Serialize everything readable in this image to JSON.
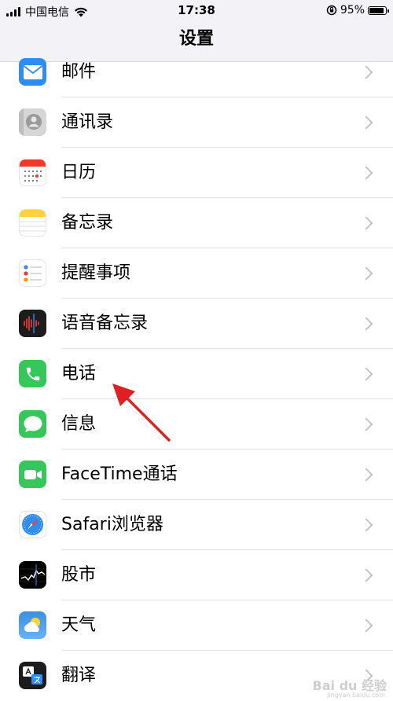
{
  "status_bar": {
    "carrier": "中国电信",
    "time": "17:38",
    "battery": "95%",
    "battery_level": 0.95
  },
  "nav": {
    "title": "设置"
  },
  "settings": [
    {
      "label": "邮件",
      "icon": "mail-icon"
    },
    {
      "label": "通讯录",
      "icon": "contacts-icon"
    },
    {
      "label": "日历",
      "icon": "calendar-icon"
    },
    {
      "label": "备忘录",
      "icon": "notes-icon"
    },
    {
      "label": "提醒事项",
      "icon": "reminders-icon"
    },
    {
      "label": "语音备忘录",
      "icon": "voice-memos-icon"
    },
    {
      "label": "电话",
      "icon": "phone-icon"
    },
    {
      "label": "信息",
      "icon": "messages-icon"
    },
    {
      "label": "FaceTime通话",
      "icon": "facetime-icon"
    },
    {
      "label": "Safari浏览器",
      "icon": "safari-icon"
    },
    {
      "label": "股市",
      "icon": "stocks-icon"
    },
    {
      "label": "天气",
      "icon": "weather-icon"
    },
    {
      "label": "翻译",
      "icon": "translate-icon"
    }
  ],
  "colors": {
    "accent_arrow": "#e02020",
    "ios_green": "#35c759",
    "mail_blue": "#2f8cf0"
  },
  "watermark": {
    "text": "Bai du 经验",
    "sub": "jingyan.baidu.com"
  }
}
